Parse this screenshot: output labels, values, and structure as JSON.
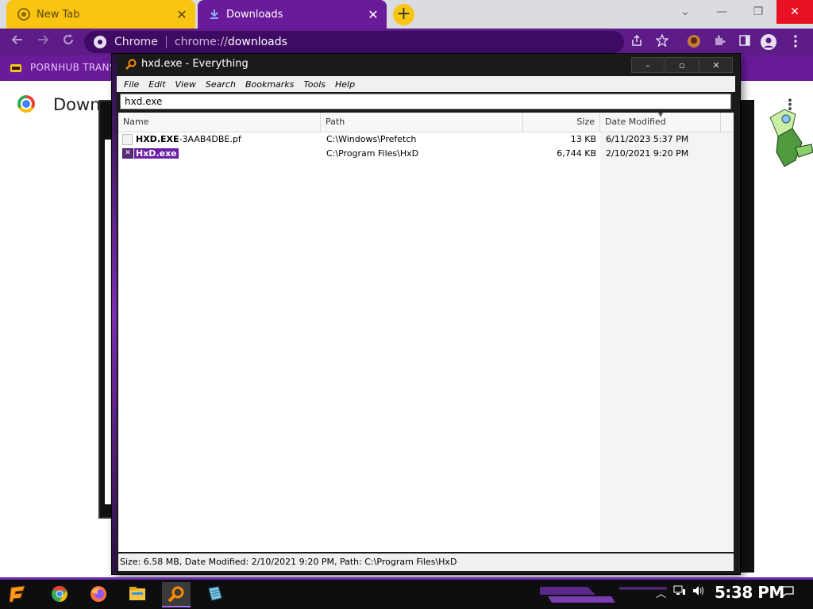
{
  "tabs": [
    {
      "label": "New Tab",
      "close": "✕"
    },
    {
      "label": "Downloads",
      "close": "✕"
    }
  ],
  "new_tab_label": "+",
  "window_controls": {
    "list": "⌄",
    "minimize": "—",
    "restore": "❐",
    "close": "✕"
  },
  "address_bar": {
    "site_name": "Chrome",
    "url_scheme": "chrome://",
    "url_host": "downloads"
  },
  "bookmark": {
    "label": "PORNHUB TRANS"
  },
  "page": {
    "title": "Down",
    "menu": "⋮"
  },
  "everything": {
    "title": "hxd.exe - Everything",
    "controls": {
      "minimize": "–",
      "maximize": "▫",
      "close": "✕"
    },
    "menu": [
      "File",
      "Edit",
      "View",
      "Search",
      "Bookmarks",
      "Tools",
      "Help"
    ],
    "search_value": "hxd.exe",
    "columns": {
      "name": "Name",
      "path": "Path",
      "size": "Size",
      "date": "Date Modified"
    },
    "rows": [
      {
        "name_bold": "HXD.EXE",
        "name_rest": "-3AAB4DBE.pf",
        "path": "C:\\Windows\\Prefetch",
        "size": "13 KB",
        "date": "6/11/2023 5:37 PM",
        "selected": false
      },
      {
        "name_bold": "HxD.exe",
        "name_rest": "",
        "path": "C:\\Program Files\\HxD",
        "size": "6,744 KB",
        "date": "2/10/2021 9:20 PM",
        "selected": true
      }
    ],
    "status": "Size: 6.58 MB, Date Modified: 2/10/2021 9:20 PM, Path: C:\\Program Files\\HxD"
  },
  "taskbar": {
    "clock": "5:38 PM",
    "apps": [
      "start-icon",
      "chrome-icon",
      "firefox-icon",
      "file-explorer-icon",
      "everything-icon",
      "notepad-icon"
    ]
  },
  "colors": {
    "tab_active": "#6a1b9a",
    "tab_inactive": "#f9c513",
    "toolbar": "#5e1c88",
    "selection": "#6a1fa8",
    "close_red": "#e81123"
  }
}
